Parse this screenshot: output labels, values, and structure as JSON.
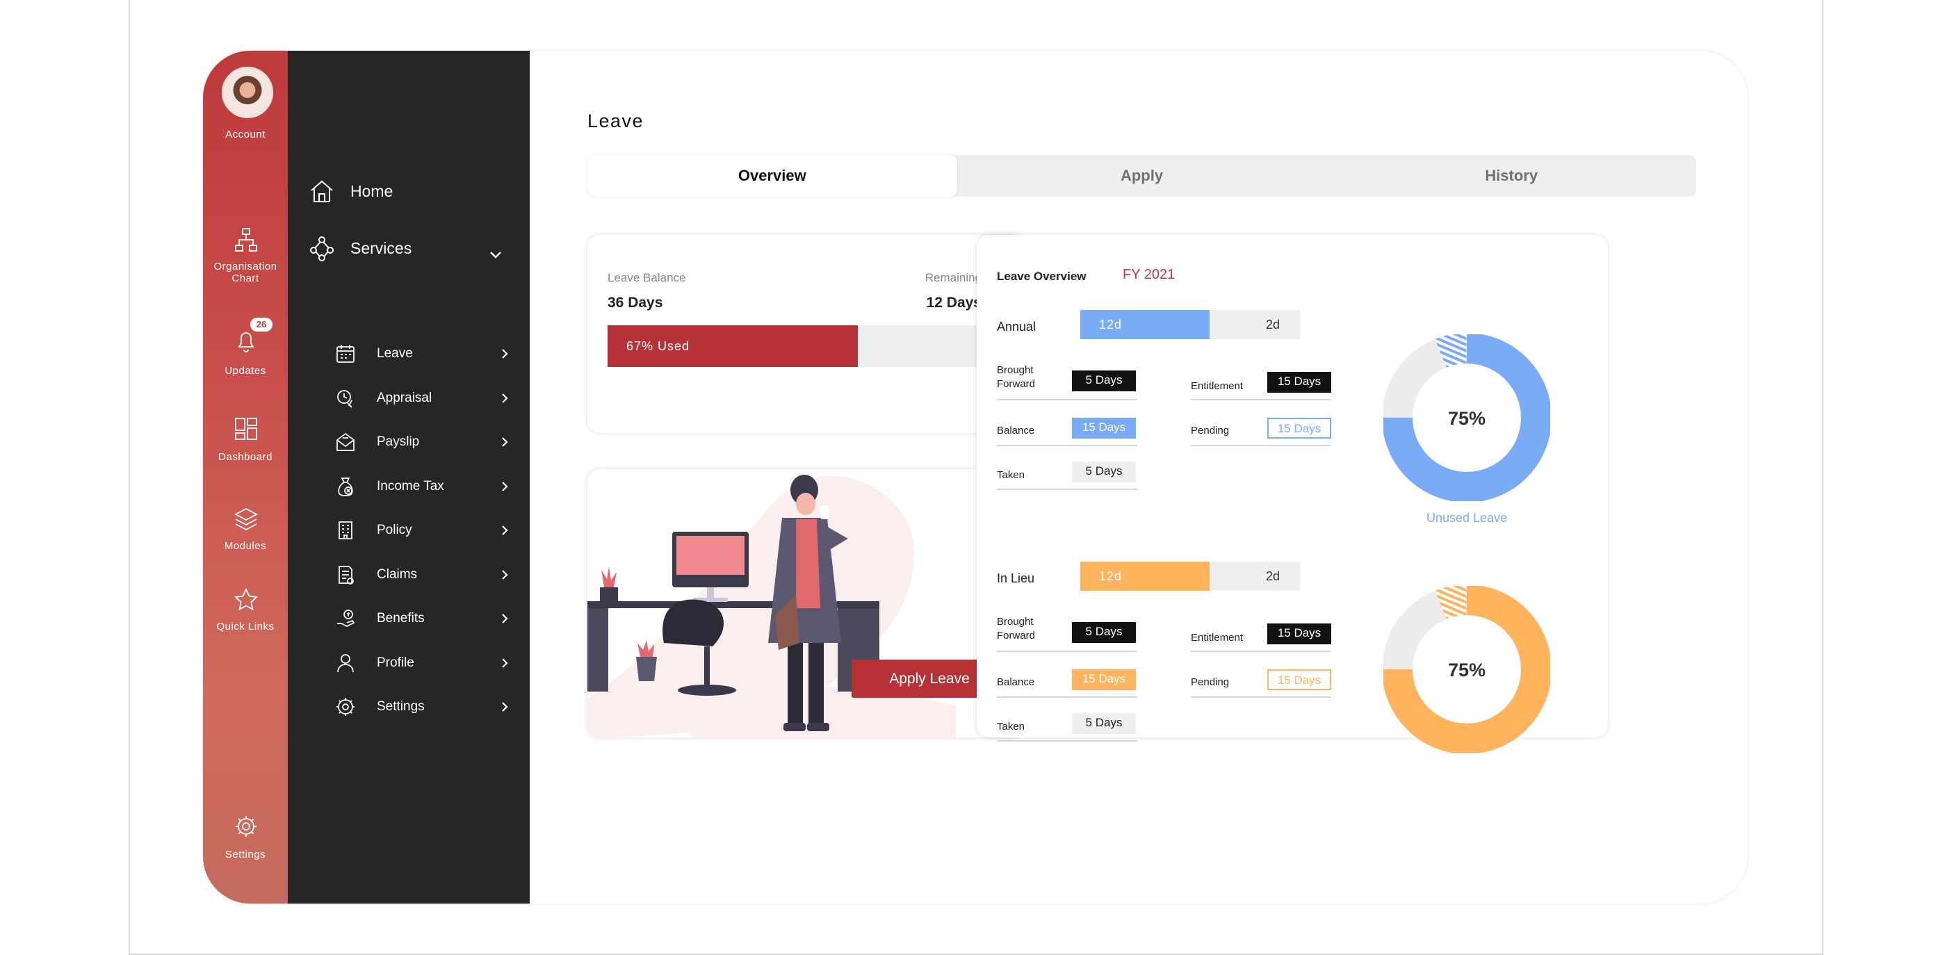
{
  "rail": {
    "account_label": "Account",
    "items": [
      {
        "label": "Organisation Chart",
        "icon": "org-chart-icon"
      },
      {
        "label": "Updates",
        "icon": "bell-icon",
        "badge": "26"
      },
      {
        "label": "Dashboard",
        "icon": "dashboard-icon"
      },
      {
        "label": "Modules",
        "icon": "layers-icon"
      },
      {
        "label": "Quick Links",
        "icon": "star-icon"
      },
      {
        "label": "Settings",
        "icon": "gear-icon"
      }
    ]
  },
  "sidebar": {
    "home": "Home",
    "services": "Services",
    "sub_items": [
      {
        "label": "Leave",
        "icon": "calendar-icon"
      },
      {
        "label": "Appraisal",
        "icon": "appraisal-icon"
      },
      {
        "label": "Payslip",
        "icon": "payslip-icon"
      },
      {
        "label": "Income Tax",
        "icon": "money-bag-icon"
      },
      {
        "label": "Policy",
        "icon": "building-icon"
      },
      {
        "label": "Claims",
        "icon": "claims-icon"
      },
      {
        "label": "Benefits",
        "icon": "benefits-icon"
      },
      {
        "label": "Profile",
        "icon": "user-icon"
      },
      {
        "label": "Settings",
        "icon": "gear-icon"
      }
    ]
  },
  "page": {
    "title": "Leave",
    "tabs": [
      "Overview",
      "Apply",
      "History"
    ],
    "active_tab": "Overview"
  },
  "balance_card": {
    "balance_label": "Leave Balance",
    "balance_value": "36 Days",
    "remaining_label": "Remaining",
    "remaining_value": "12 Days",
    "used_text": "67% Used",
    "used_fraction": 0.67
  },
  "illustration_card": {
    "apply_button": "Apply Leave"
  },
  "overview": {
    "title": "Leave Overview",
    "fy": "FY 2021",
    "labels": {
      "brought_forward_1": "Brought",
      "brought_forward_2": "Forward",
      "entitlement": "Entitlement",
      "balance": "Balance",
      "pending": "Pending",
      "taken": "Taken"
    },
    "types": [
      {
        "name": "Annual",
        "used": "12d",
        "rest": "2d",
        "fill_fraction": 0.59,
        "brought_forward": "5 Days",
        "entitlement": "15 Days",
        "balance": "15 Days",
        "pending": "15 Days",
        "taken": "5 Days",
        "donut_percent": "75%",
        "donut_value": 0.75,
        "caption": "Unused Leave"
      },
      {
        "name": "In Lieu",
        "used": "12d",
        "rest": "2d",
        "fill_fraction": 0.59,
        "brought_forward": "5 Days",
        "entitlement": "15 Days",
        "balance": "15 Days",
        "pending": "15 Days",
        "taken": "5 Days",
        "donut_percent": "75%",
        "donut_value": 0.75
      }
    ]
  },
  "colors": {
    "accent_red": "#b73236",
    "blue": "#7aabf7",
    "orange": "#ffb35d",
    "sidebar_dark": "#262626"
  }
}
